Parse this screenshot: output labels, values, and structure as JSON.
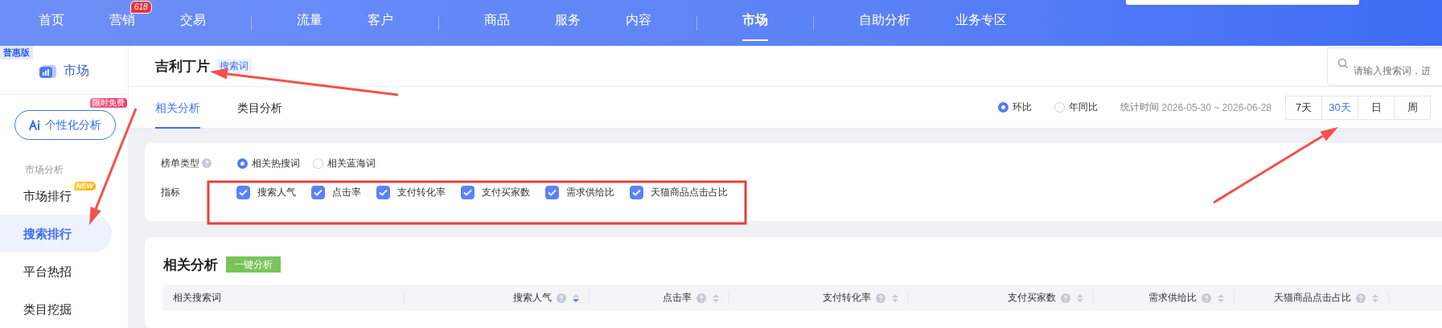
{
  "top_nav": {
    "groups": [
      [
        {
          "label": "首页",
          "selected": false
        },
        {
          "label": "营销",
          "selected": false,
          "badge": "618"
        },
        {
          "label": "交易",
          "selected": false
        }
      ],
      [
        {
          "label": "流量",
          "selected": false
        },
        {
          "label": "客户",
          "selected": false
        }
      ],
      [
        {
          "label": "商品",
          "selected": false
        },
        {
          "label": "服务",
          "selected": false
        },
        {
          "label": "内容",
          "selected": false
        }
      ],
      [
        {
          "label": "市场",
          "selected": true
        }
      ],
      [
        {
          "label": "自助分析",
          "selected": false
        },
        {
          "label": "业务专区",
          "selected": false
        }
      ]
    ]
  },
  "sidebar": {
    "edition_badge": "普惠版",
    "title": "市场",
    "feature_button": {
      "label": "个性化分析",
      "badge": "限时免费"
    },
    "sections": [
      {
        "heading": "市场分析",
        "items": [
          {
            "label": "市场排行",
            "badge": "NEW",
            "selected": false
          },
          {
            "label": "搜索排行",
            "selected": true
          },
          {
            "label": "平台热招",
            "selected": false
          },
          {
            "label": "类目挖掘",
            "selected": false
          }
        ]
      }
    ]
  },
  "header": {
    "keyword": "吉利丁片",
    "tag": "搜索词",
    "search": {
      "placeholder": "请输入搜索词，进"
    }
  },
  "tabs": [
    {
      "label": "相关分析",
      "selected": true
    },
    {
      "label": "类目分析",
      "selected": false
    }
  ],
  "compare": [
    {
      "label": "环比",
      "selected": true
    },
    {
      "label": "年同比",
      "selected": false
    }
  ],
  "stat_time": {
    "label": "统计时间",
    "value": "2026-05-30 ~ 2026-06-28"
  },
  "periods": [
    {
      "label": "7天",
      "selected": false
    },
    {
      "label": "30天",
      "selected": true
    },
    {
      "label": "日",
      "selected": false
    },
    {
      "label": "周",
      "selected": false
    }
  ],
  "filters": {
    "list_type": {
      "label": "榜单类型",
      "options": [
        {
          "label": "相关热搜词",
          "selected": true
        },
        {
          "label": "相关蓝海词",
          "selected": false
        }
      ]
    },
    "metrics": {
      "label": "指标",
      "options": [
        {
          "label": "搜索人气",
          "checked": true
        },
        {
          "label": "点击率",
          "checked": true
        },
        {
          "label": "支付转化率",
          "checked": true
        },
        {
          "label": "支付买家数",
          "checked": true
        },
        {
          "label": "需求供给比",
          "checked": true
        },
        {
          "label": "天猫商品点击占比",
          "checked": true
        }
      ]
    }
  },
  "table": {
    "title": "相关分析",
    "action": "一键分析",
    "columns": [
      {
        "label": "相关搜索词"
      },
      {
        "label": "搜索人气",
        "help": true,
        "sorted_desc": true
      },
      {
        "label": "点击率",
        "help": true,
        "sorted_desc": false
      },
      {
        "label": "支付转化率",
        "help": true,
        "sorted_desc": false
      },
      {
        "label": "支付买家数",
        "help": true,
        "sorted_desc": false
      },
      {
        "label": "需求供给比",
        "help": true,
        "sorted_desc": false
      },
      {
        "label": "天猫商品点击占比",
        "help": true,
        "sorted_desc": false
      }
    ]
  }
}
